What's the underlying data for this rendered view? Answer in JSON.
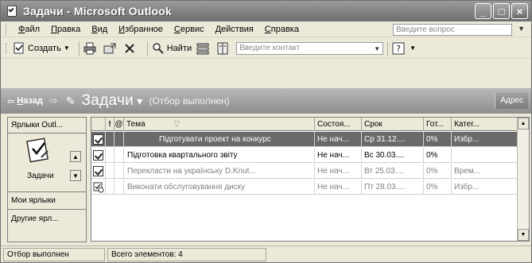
{
  "window": {
    "title": "Задачи - Microsoft Outlook",
    "controls": {
      "minimize": "_",
      "maximize": "□",
      "close": "×"
    }
  },
  "menu": {
    "items": [
      {
        "label": "Файл",
        "underline": "Ф",
        "rest": "айл"
      },
      {
        "label": "Правка",
        "underline": "П",
        "rest": "равка"
      },
      {
        "label": "Вид",
        "underline": "В",
        "rest": "ид"
      },
      {
        "label": "Избранное",
        "underline": "И",
        "rest": "збранное"
      },
      {
        "label": "Сервис",
        "underline": "С",
        "rest": "ервис"
      },
      {
        "label": "Действия",
        "underline": "Д",
        "rest": "ействия"
      },
      {
        "label": "Справка",
        "underline": "С",
        "rest": "правка"
      }
    ],
    "ask_placeholder": "Введите вопрос"
  },
  "toolbar": {
    "new_label": "Создать",
    "find_label": "Найти",
    "contact_placeholder": "Введите контакт",
    "help_glyph": "?"
  },
  "nav": {
    "back_u": "Н",
    "back_rest": "азад",
    "folder": "Задачи",
    "filter_note": "(Отбор выполнен)",
    "address": "Адрес"
  },
  "outlookbar": {
    "top_button": "Ярлыки Outl...",
    "group_label": "Задачи",
    "my_shortcuts": "Мои ярлыки",
    "other": "Другие ярл..."
  },
  "grid": {
    "columns": [
      "",
      "!",
      "@",
      "Тема",
      "Состоя...",
      "Срок",
      "Гот...",
      "Катег..."
    ],
    "rows": [
      {
        "subject": "Підготувати проект на конкурс",
        "status": "Не нач...",
        "due": "Ср 31.12....",
        "done": "0%",
        "category": "Избр...",
        "selected": true,
        "dim": false
      },
      {
        "subject": "Підготовка квартального звіту",
        "status": "Не нач...",
        "due": "Вс 30.03....",
        "done": "0%",
        "category": "",
        "selected": false,
        "dim": false
      },
      {
        "subject": "Перекласти на українську D.Knut...",
        "status": "Не нач...",
        "due": "Вт 25.03....",
        "done": "0%",
        "category": "Врем...",
        "selected": false,
        "dim": true
      },
      {
        "subject": "Виконати обслуговування диску",
        "status": "Не нач...",
        "due": "Пт 28.03....",
        "done": "0%",
        "category": "Избр...",
        "selected": false,
        "dim": true
      }
    ]
  },
  "status": {
    "filter": "Отбор выполнен",
    "count": "Всего элементов: 4"
  },
  "colors": {
    "selected_row": "#6a6a6a",
    "titlebar": "#7e7e7e",
    "chrome": "#ece9d8"
  }
}
